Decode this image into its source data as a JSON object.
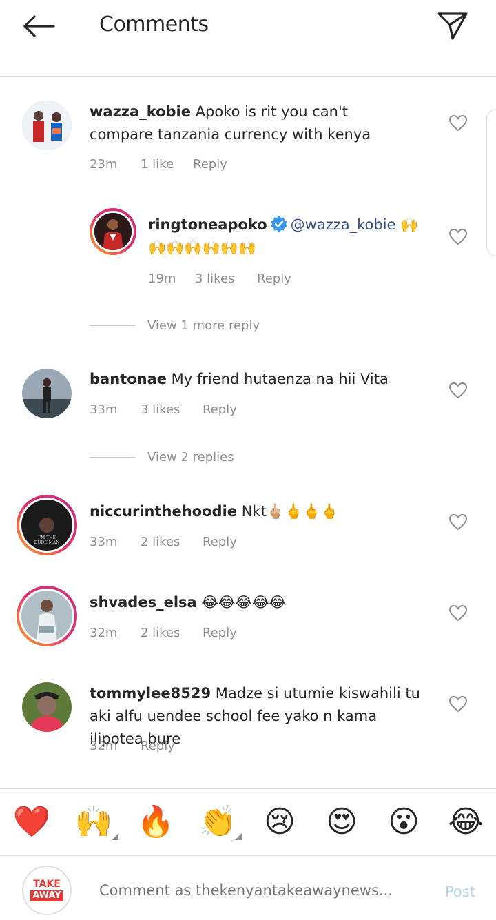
{
  "header": {
    "title": "Comments"
  },
  "comments": [
    {
      "username": "wazza_kobie",
      "text": "Apoko is rit you can't compare tanzania currency with kenya",
      "time": "23m",
      "likes": "1 like",
      "reply": "Reply"
    },
    {
      "username": "ringtoneapoko",
      "mention": "@wazza_kobie",
      "text": "🙌 🙌🙌🙌🙌🙌🙌",
      "time": "19m",
      "likes": "3 likes",
      "reply": "Reply"
    },
    {
      "username": "bantonae",
      "text": "My friend hutaenza na hii Vita",
      "time": "33m",
      "likes": "3 likes",
      "reply": "Reply"
    },
    {
      "username": "niccurinthehoodie",
      "text": "Nkt🖕🏼🖕🖕🖕",
      "time": "33m",
      "likes": "2 likes",
      "reply": "Reply"
    },
    {
      "username": "shvades_elsa",
      "text": "😂😂😂😂😂",
      "time": "32m",
      "likes": "2 likes",
      "reply": "Reply"
    },
    {
      "username": "tommylee8529",
      "text": "Madze si utumie kiswahili tu  aki alfu uendee school fee yako n kama ilipotea bure",
      "time": "32m",
      "likes": "",
      "reply": "Reply"
    }
  ],
  "view_replies": [
    "View 1 more reply",
    "View 2 replies"
  ],
  "avatar_text": {
    "niccurinthehoodie": "I'M THE DUDE MAN"
  },
  "emoji_bar": [
    "❤️",
    "🙌",
    "🔥",
    "👏",
    "😢",
    "😍",
    "😮",
    "😂"
  ],
  "composer": {
    "placeholder": "Comment as thekenyantakeawaynews...",
    "post_label": "Post",
    "logo_top": "TAKE",
    "logo_bottom": "AWAY"
  },
  "colors": {
    "mention": "#385185",
    "meta": "#8e8e8e",
    "post_disabled": "#b3d4f5",
    "story_ring": "#e1306c",
    "verified": "#3897f0"
  },
  "icons": [
    "back-arrow-icon",
    "send-icon",
    "heart-outline-icon",
    "verified-badge-icon"
  ]
}
